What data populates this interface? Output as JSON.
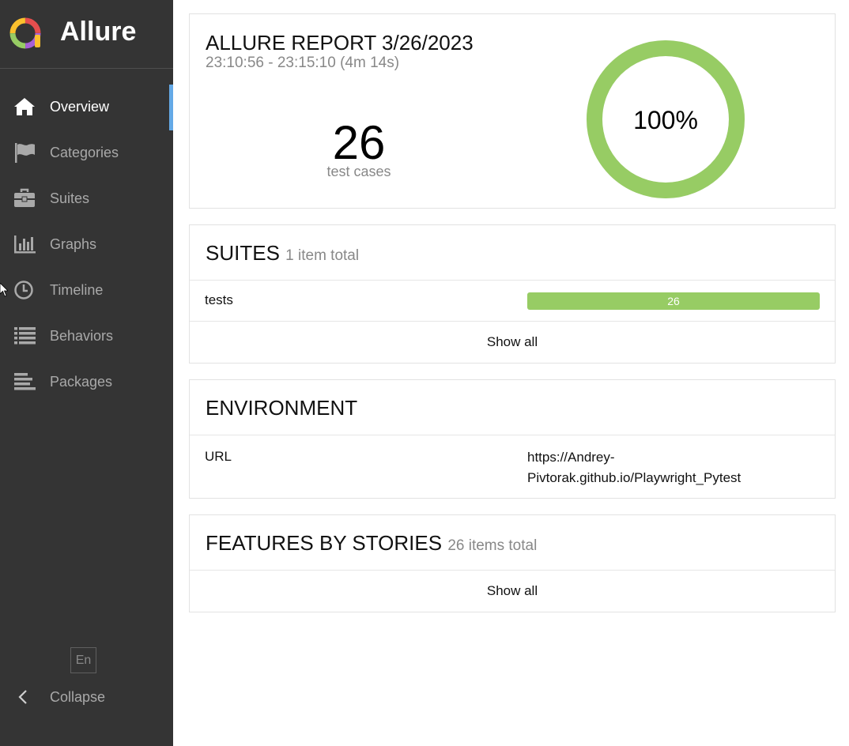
{
  "sidebar": {
    "brand": "Allure",
    "items": [
      {
        "label": "Overview",
        "active": true
      },
      {
        "label": "Categories"
      },
      {
        "label": "Suites"
      },
      {
        "label": "Graphs"
      },
      {
        "label": "Timeline"
      },
      {
        "label": "Behaviors"
      },
      {
        "label": "Packages"
      }
    ],
    "language": "En",
    "collapse_label": "Collapse"
  },
  "summary": {
    "title": "ALLURE REPORT 3/26/2023",
    "time_range": "23:10:56 - 23:15:10 (4m 14s)",
    "test_count": "26",
    "test_count_label": "test cases",
    "pass_rate": "100%",
    "pass_fraction": 1.0
  },
  "suites": {
    "title": "SUITES",
    "subtitle": "1 item total",
    "rows": [
      {
        "name": "tests",
        "passed": "26"
      }
    ],
    "show_all": "Show all"
  },
  "environment": {
    "title": "ENVIRONMENT",
    "rows": [
      {
        "key": "URL",
        "value": "https://Andrey-Pivtorak.github.io/Playwright_Pytest"
      }
    ]
  },
  "features": {
    "title": "FEATURES BY STORIES",
    "subtitle": "26 items total",
    "show_all": "Show all"
  },
  "colors": {
    "sidebar_bg": "#343434",
    "active_indicator": "#64a9e6",
    "passed": "#97cc64",
    "muted_text": "#888888"
  },
  "icons": {
    "overview": "home-icon",
    "categories": "flag-icon",
    "suites": "briefcase-icon",
    "graphs": "bar-chart-icon",
    "timeline": "clock-icon",
    "behaviors": "list-icon",
    "packages": "align-left-icon",
    "collapse": "chevron-left-icon"
  }
}
